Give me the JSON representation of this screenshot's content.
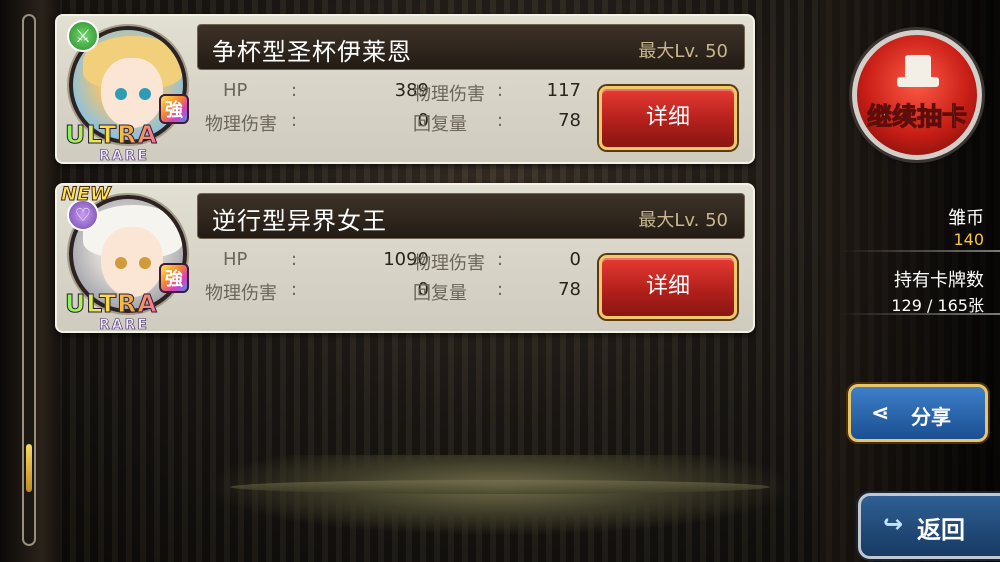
{
  "cards": [
    {
      "name": "争杯型圣杯伊莱恩",
      "max_lv": "最大Lv. 50",
      "stats": {
        "hp_label": "HP",
        "hp": "389",
        "atk_label": "物理伤害",
        "atk": "117",
        "def_label": "物理伤害",
        "def": "0",
        "heal_label": "回复量",
        "heal": "78"
      },
      "rarity": "ULTRA",
      "rarity_sub": "RARE",
      "strong_badge": "強",
      "element_icon": "crossed-swords-icon",
      "element_color": "#3fae3b",
      "new": false,
      "detail_label": "详细"
    },
    {
      "name": "逆行型异界女王",
      "max_lv": "最大Lv. 50",
      "stats": {
        "hp_label": "HP",
        "hp": "1090",
        "atk_label": "物理伤害",
        "atk": "0",
        "def_label": "物理伤害",
        "def": "0",
        "heal_label": "回复量",
        "heal": "78"
      },
      "rarity": "ULTRA",
      "rarity_sub": "RARE",
      "strong_badge": "強",
      "element_icon": "heart-icon",
      "element_color": "#8a5dc4",
      "new": true,
      "new_label": "NEW",
      "detail_label": "详细"
    }
  ],
  "colon": ":",
  "gacha_button": {
    "label": "继续抽卡",
    "icon": "gacha-machine-icon"
  },
  "currency": {
    "label": "雏币",
    "value": "140",
    "value_color": "#f5c542"
  },
  "card_count": {
    "label": "持有卡牌数",
    "value": "129 / 165张"
  },
  "share_button": {
    "label": "分享",
    "icon": "share-icon"
  },
  "back_button": {
    "label": "返回",
    "icon": "return-arrow-icon"
  }
}
